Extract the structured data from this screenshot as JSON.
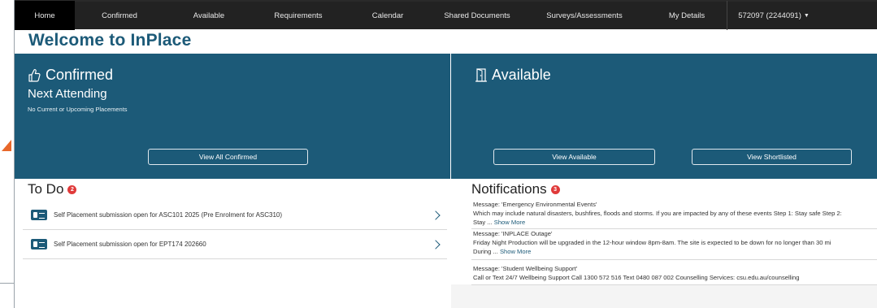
{
  "nav": {
    "items": [
      "Home",
      "Confirmed",
      "Available",
      "Requirements",
      "Calendar",
      "Shared Documents",
      "Surveys/Assessments",
      "My Details"
    ],
    "user": "572097 (2244091)"
  },
  "page": {
    "title": "Welcome to InPlace"
  },
  "confirmed": {
    "title": "Confirmed",
    "subtitle": "Next Attending",
    "note": "No Current or Upcoming Placements",
    "button": "View All Confirmed"
  },
  "available": {
    "title": "Available",
    "button_available": "View Available",
    "button_shortlisted": "View Shortlisted"
  },
  "todo": {
    "title": "To Do",
    "count": "2",
    "items": [
      {
        "text": "Self Placement submission open for ASC101 2025 (Pre Enrolment for ASC310)"
      },
      {
        "text": "Self Placement submission open for EPT174 202660"
      }
    ]
  },
  "notifications": {
    "title": "Notifications",
    "count": "3",
    "items": [
      {
        "line1": "Message: 'Emergency Environmental Events'",
        "line2": "Which may include natural disasters, bushfires, floods and storms. If you are impacted by any of these events Step 1: Stay safe Step 2:",
        "line3": "Stay ...",
        "more": "Show More"
      },
      {
        "line1": "Message: 'INPLACE Outage'",
        "line2": "Friday Night Production will be upgraded in the 12-hour window 8pm-8am. The site is expected to be down for no longer than 30 mi",
        "line3": "During ...",
        "more": "Show More"
      },
      {
        "line1": "Message: 'Student Wellbeing Support'",
        "line2": "Call or Text 24/7 Wellbeing Support Call 1300 572 516 Text 0480 087 002 Counselling Services: csu.edu.au/counselling"
      }
    ]
  },
  "colors": {
    "primary": "#1c5a78",
    "nav_bg": "#222222",
    "badge": "#e03a3a",
    "arrow": "#e8672a"
  },
  "icons": {
    "confirmed": "thumbs-up-icon",
    "available": "door-icon",
    "todo_item": "id-card-icon",
    "row_action": "chevron-right-icon"
  }
}
